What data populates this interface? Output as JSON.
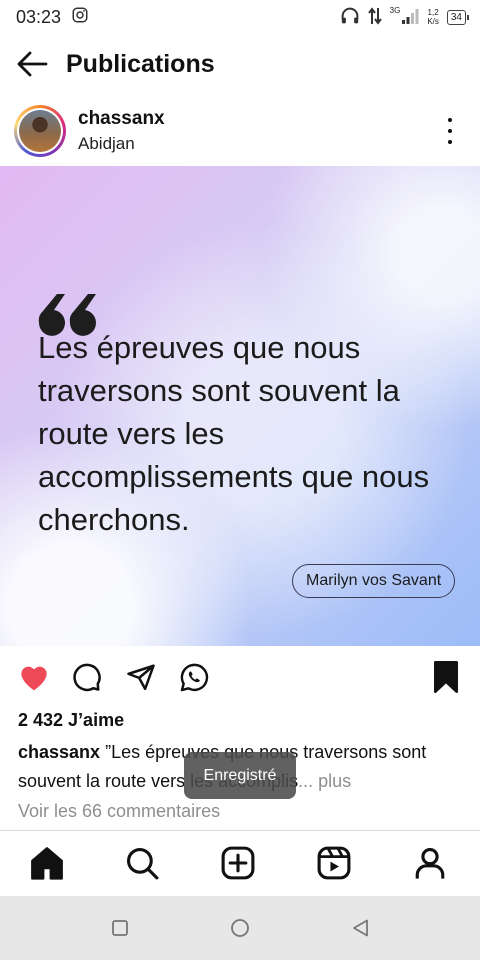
{
  "status_bar": {
    "time": "03:23",
    "network": "3G",
    "speed_value": "1,2",
    "speed_unit": "K/s",
    "battery": "34",
    "icons": [
      "instagram-notification-icon",
      "headphones-icon",
      "data-transfer-icon",
      "signal-icon",
      "battery-icon"
    ]
  },
  "header": {
    "title": "Publications",
    "back_icon": "arrow-left-icon"
  },
  "post": {
    "username": "chassanx",
    "location": "Abidjan",
    "more_icon": "vertical-dots-icon",
    "image": {
      "quote_mark": "66",
      "quote_text": "Les épreuves que nous traversons sont souvent la route vers les accomplissements que nous cherchons.",
      "author": "Marilyn vos Savant"
    },
    "actions": {
      "like_icon": "heart-filled-icon",
      "comment_icon": "comment-bubble-icon",
      "share_icon": "send-icon",
      "whatsapp_icon": "whatsapp-icon",
      "save_icon": "bookmark-filled-icon",
      "liked": true,
      "saved": true
    },
    "likes": "2 432 J’aime",
    "caption_user": "chassanx",
    "caption_text": "”Les épreuves que nous traversons sont souvent la route vers les accomplis",
    "caption_ellipsis": "...",
    "caption_more": "plus",
    "view_comments": "Voir les 66 commentaires"
  },
  "toast": {
    "text": "Enregistré"
  },
  "bottom_nav": {
    "items": [
      "home-icon",
      "search-icon",
      "create-icon",
      "reels-icon",
      "profile-icon"
    ]
  },
  "system_nav": {
    "items": [
      "recent-apps-icon",
      "home-circle-icon",
      "back-triangle-icon"
    ]
  },
  "colors": {
    "like_red": "#ed4956",
    "secondary_text": "#8e8e8e",
    "toast_bg": "#4b4b4b"
  }
}
